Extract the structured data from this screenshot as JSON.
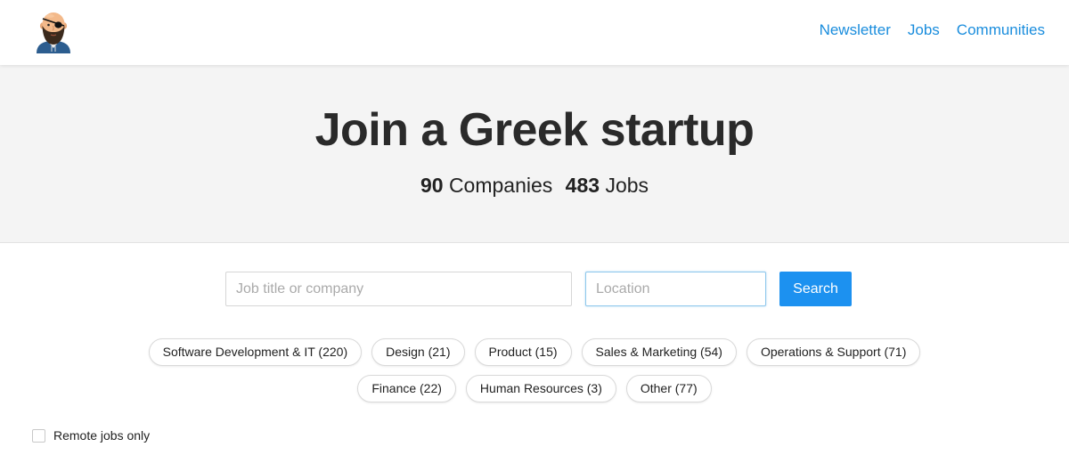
{
  "colors": {
    "accent": "#1a8ddd",
    "button": "#1c91f0",
    "hero_bg": "#f4f4f4"
  },
  "header": {
    "logo_icon": "bearded-pirate-avatar-icon",
    "nav": [
      {
        "label": "Newsletter"
      },
      {
        "label": "Jobs"
      },
      {
        "label": "Communities"
      }
    ]
  },
  "hero": {
    "title": "Join a Greek startup",
    "companies_count": "90",
    "companies_label": "Companies",
    "jobs_count": "483",
    "jobs_label": "Jobs"
  },
  "search": {
    "query_placeholder": "Job title or company",
    "query_value": "",
    "location_placeholder": "Location",
    "location_value": "",
    "button_label": "Search"
  },
  "categories": [
    {
      "label": "Software Development & IT (220)"
    },
    {
      "label": "Design (21)"
    },
    {
      "label": "Product (15)"
    },
    {
      "label": "Sales & Marketing (54)"
    },
    {
      "label": "Operations & Support (71)"
    },
    {
      "label": "Finance (22)"
    },
    {
      "label": "Human Resources (3)"
    },
    {
      "label": "Other (77)"
    }
  ],
  "filters": {
    "remote_label": "Remote jobs only",
    "remote_checked": false
  }
}
